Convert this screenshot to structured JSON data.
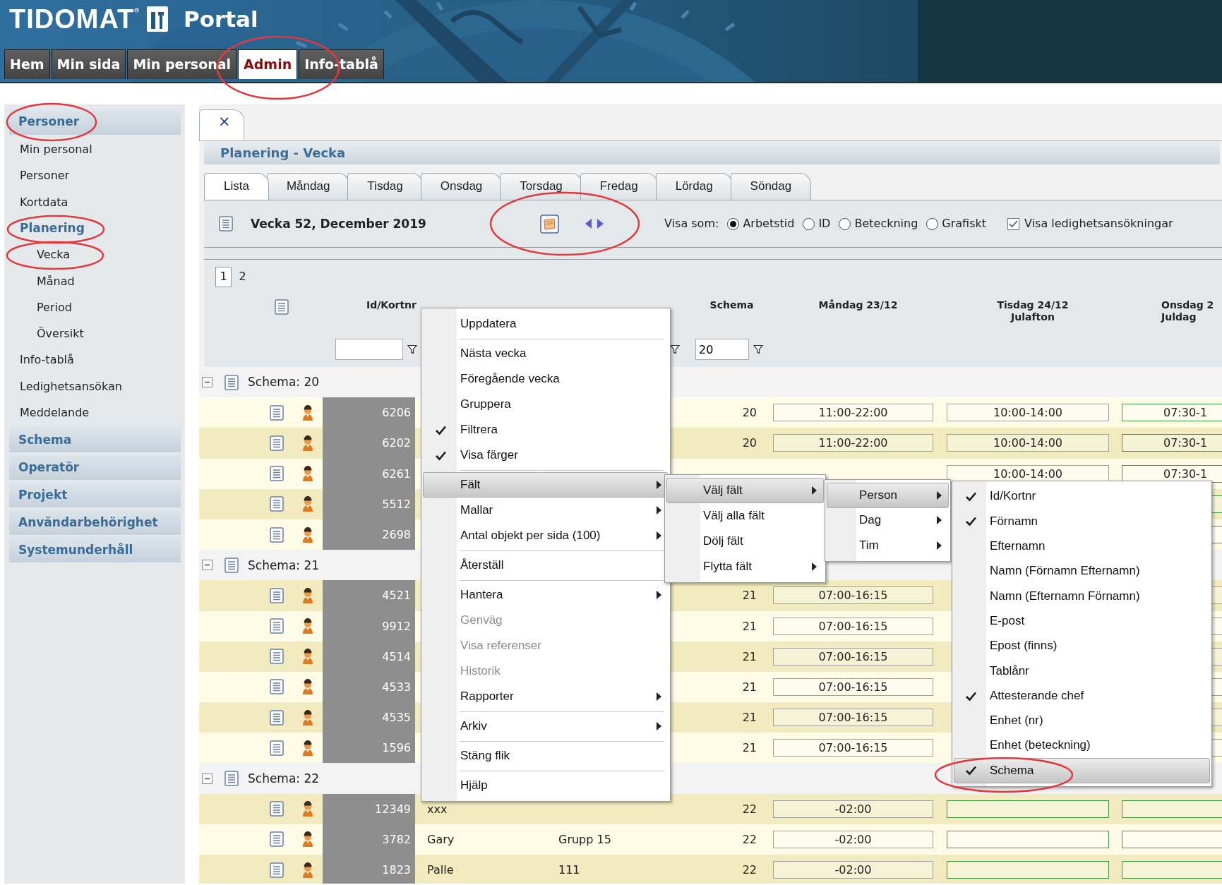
{
  "header": {
    "logo": "TIDOMAT$^{®}$",
    "title": "Portal"
  },
  "nav_tabs": [
    {
      "label": "Hem",
      "selected": false
    },
    {
      "label": "Min sida",
      "selected": false
    },
    {
      "label": "Min personal",
      "selected": false
    },
    {
      "label": "Admin",
      "selected": true
    },
    {
      "label": "Info-tablå",
      "selected": false
    }
  ],
  "sidebar": {
    "sections": [
      {
        "label": "Personer",
        "items": [
          {
            "label": "Min personal",
            "expanded": false
          },
          {
            "label": "Personer",
            "expanded": false
          },
          {
            "label": "Kortdata",
            "expanded": false
          },
          {
            "label": "Planering",
            "expanded": true,
            "children": [
              {
                "label": "Vecka"
              },
              {
                "label": "Månad"
              },
              {
                "label": "Period"
              },
              {
                "label": "Översikt"
              }
            ]
          },
          {
            "label": "Info-tablå",
            "expanded": false
          },
          {
            "label": "Ledighetsansökan",
            "expanded": false
          },
          {
            "label": "Meddelande",
            "expanded": false
          }
        ]
      },
      {
        "label": "Schema"
      },
      {
        "label": "Operatör"
      },
      {
        "label": "Projekt"
      },
      {
        "label": "Användarbehörighet"
      },
      {
        "label": "Systemunderhåll"
      }
    ]
  },
  "document_tab": {
    "close": "×"
  },
  "panel_title": "Planering - Vecka",
  "day_tabs": [
    {
      "label": "Lista",
      "selected": true
    },
    {
      "label": "Måndag",
      "selected": false
    },
    {
      "label": "Tisdag",
      "selected": false
    },
    {
      "label": "Onsdag",
      "selected": false
    },
    {
      "label": "Torsdag",
      "selected": false
    },
    {
      "label": "Fredag",
      "selected": false
    },
    {
      "label": "Lördag",
      "selected": false
    },
    {
      "label": "Söndag",
      "selected": false
    }
  ],
  "toolbar": {
    "week": "Vecka 52, December 2019",
    "view_label": "Visa som:",
    "view_options": [
      {
        "label": "Arbetstid",
        "selected": true
      },
      {
        "label": "ID",
        "selected": false
      },
      {
        "label": "Beteckning",
        "selected": false
      },
      {
        "label": "Grafiskt",
        "selected": false
      }
    ],
    "leave_requests": {
      "label": "Visa ledighetsansökningar",
      "checked": true
    }
  },
  "pager": [
    {
      "label": "1",
      "selected": true
    },
    {
      "label": "2",
      "selected": false
    }
  ],
  "table": {
    "headers": {
      "id": "Id/Kortnr",
      "schema": "Schema",
      "monday": [
        "Måndag 23/12"
      ],
      "tuesday": [
        "Tisdag 24/12",
        "Julafton"
      ],
      "wednesday": [
        "Onsdag 2",
        "Juldag"
      ]
    },
    "filters": {
      "schema": "20"
    },
    "groups": [
      {
        "label": "Schema: 20",
        "expanded": true,
        "rows": [
          {
            "id": "6206",
            "schema": "20",
            "monday": {
              "text": "11:00-22:00",
              "color": "#a0a0a0"
            },
            "tuesday": {
              "text": "10:00-14:00",
              "color": "#a0a0a0"
            },
            "wednesday": {
              "text": "07:30-1",
              "color": "#3c9a3c"
            }
          },
          {
            "id": "6202",
            "schema": "20",
            "monday": {
              "text": "11:00-22:00",
              "color": "#a0a0a0"
            },
            "tuesday": {
              "text": "10:00-14:00",
              "color": "#a0a0a0"
            },
            "wednesday": {
              "text": "07:30-1",
              "color": "#3c9a3c"
            }
          },
          {
            "id": "6261",
            "tuesday": {
              "text": "10:00-14:00",
              "color": "#a0a0a0"
            },
            "wednesday": {
              "text": "07:30-1",
              "color": "#3c9a3c"
            }
          },
          {
            "id": "5512",
            "wednesday": {
              "color": "#3c9a3c"
            }
          },
          {
            "id": "2698",
            "wednesday": {
              "color": "#3c9a3c"
            }
          }
        ]
      },
      {
        "label": "Schema: 21",
        "expanded": true,
        "rows": [
          {
            "id": "4521",
            "schema": "21",
            "monday": {
              "text": "07:00-16:15",
              "color": "#a0a0a0"
            },
            "wednesday": {
              "color": "#a0a0a0"
            }
          },
          {
            "id": "9912",
            "schema": "21",
            "monday": {
              "text": "07:00-16:15",
              "color": "#a0a0a0"
            },
            "wednesday": {
              "color": "#a0a0a0"
            }
          },
          {
            "id": "4514",
            "schema": "21",
            "monday": {
              "text": "07:00-16:15",
              "color": "#a0a0a0"
            },
            "wednesday": {
              "color": "#a0a0a0"
            }
          },
          {
            "id": "4533",
            "schema": "21",
            "monday": {
              "text": "07:00-16:15",
              "color": "#a0a0a0"
            },
            "wednesday": {
              "color": "#a0a0a0"
            }
          },
          {
            "id": "4535",
            "schema": "21",
            "monday": {
              "text": "07:00-16:15",
              "color": "#a0a0a0"
            },
            "wednesday": {
              "color": "#a0a0a0"
            }
          },
          {
            "id": "1596",
            "schema": "21",
            "monday": {
              "text": "07:00-16:15",
              "color": "#a0a0a0"
            },
            "wednesday": {
              "color": "#a0a0a0"
            }
          }
        ]
      },
      {
        "label": "Schema: 22",
        "expanded": true,
        "rows": [
          {
            "id": "12349",
            "column_3": "xxx",
            "schema": "22",
            "monday": {
              "text": "-02:00",
              "color": "#a0a0a0"
            },
            "tuesday": {
              "color": "#3c9a3c"
            },
            "wednesday": {
              "color": "#3c9a3c"
            }
          },
          {
            "id": "3782",
            "column_3": "Gary",
            "column_4": "Grupp 15",
            "schema": "22",
            "monday": {
              "text": "-02:00",
              "color": "#a0a0a0"
            },
            "tuesday": {
              "color": "#3c9a3c"
            },
            "wednesday": {
              "color": "#3c9a3c"
            }
          },
          {
            "id": "1823",
            "column_3": "Palle",
            "column_4": "111",
            "schema": "22",
            "monday": {
              "text": "-02:00",
              "color": "#a0a0a0"
            },
            "tuesday": {
              "color": "#3c9a3c"
            },
            "wednesday": {
              "color": "#3c9a3c"
            }
          }
        ]
      }
    ]
  },
  "context_menu": {
    "groups": [
      [
        {
          "label": "Uppdatera",
          "checked": false,
          "selected": false,
          "disabled": false,
          "submenu": false
        }
      ],
      [
        {
          "label": "Nästa vecka",
          "checked": false,
          "selected": false,
          "disabled": false,
          "submenu": false
        },
        {
          "label": "Föregående vecka",
          "checked": false,
          "selected": false,
          "disabled": false,
          "submenu": false
        },
        {
          "label": "Gruppera",
          "checked": false,
          "selected": false,
          "disabled": false,
          "submenu": false
        },
        {
          "label": "Filtrera",
          "checked": true,
          "selected": false,
          "disabled": false,
          "submenu": false
        },
        {
          "label": "Visa färger",
          "checked": true,
          "selected": false,
          "disabled": false,
          "submenu": false
        }
      ],
      [
        {
          "label": "Fält",
          "checked": false,
          "selected": true,
          "disabled": false,
          "submenu": true
        },
        {
          "label": "Mallar",
          "checked": false,
          "selected": false,
          "disabled": false,
          "submenu": true
        },
        {
          "label": "Antal objekt per sida (100)",
          "checked": false,
          "selected": false,
          "disabled": false,
          "submenu": true
        }
      ],
      [
        {
          "label": "Återställ",
          "checked": false,
          "selected": false,
          "disabled": false,
          "submenu": false
        }
      ],
      [
        {
          "label": "Hantera",
          "checked": false,
          "selected": false,
          "disabled": false,
          "submenu": true
        },
        {
          "label": "Genväg",
          "checked": false,
          "selected": false,
          "disabled": true,
          "submenu": false
        },
        {
          "label": "Visa referenser",
          "checked": false,
          "selected": false,
          "disabled": true,
          "submenu": false
        },
        {
          "label": "Historik",
          "checked": false,
          "selected": false,
          "disabled": true,
          "submenu": false
        },
        {
          "label": "Rapporter",
          "checked": false,
          "selected": false,
          "disabled": false,
          "submenu": true
        }
      ],
      [
        {
          "label": "Arkiv",
          "checked": false,
          "selected": false,
          "disabled": false,
          "submenu": true
        }
      ],
      [
        {
          "label": "Stäng flik",
          "checked": false,
          "selected": false,
          "disabled": false,
          "submenu": false
        }
      ],
      [
        {
          "label": "Hjälp",
          "checked": false,
          "selected": false,
          "disabled": false,
          "submenu": false
        }
      ]
    ]
  },
  "submenus": [
    {
      "groups": [
        [
          {
            "label": "Välj fält",
            "checked": false,
            "selected": true,
            "disabled": false,
            "submenu": true
          },
          {
            "label": "Välj alla fält",
            "checked": false,
            "selected": false,
            "disabled": false,
            "submenu": false
          },
          {
            "label": "Dölj fält",
            "checked": false,
            "selected": false,
            "disabled": false,
            "submenu": false
          },
          {
            "label": "Flytta fält",
            "checked": false,
            "selected": false,
            "disabled": false,
            "submenu": true
          }
        ]
      ]
    },
    {
      "groups": [
        [
          {
            "label": "Person",
            "checked": false,
            "selected": true,
            "disabled": false,
            "submenu": true
          },
          {
            "label": "Dag",
            "checked": false,
            "selected": false,
            "disabled": false,
            "submenu": true
          },
          {
            "label": "Tim",
            "checked": false,
            "selected": false,
            "disabled": false,
            "submenu": true
          }
        ]
      ]
    },
    {
      "groups": [
        [
          {
            "label": "Id/Kortnr",
            "checked": true,
            "selected": false,
            "disabled": false,
            "submenu": false
          },
          {
            "label": "Förnamn",
            "checked": true,
            "selected": false,
            "disabled": false,
            "submenu": false
          },
          {
            "label": "Efternamn",
            "checked": false,
            "selected": false,
            "disabled": false,
            "submenu": false
          },
          {
            "label": "Namn (Förnamn Efternamn)",
            "checked": false,
            "selected": false,
            "disabled": false,
            "submenu": false
          },
          {
            "label": "Namn (Efternamn Förnamn)",
            "checked": false,
            "selected": false,
            "disabled": false,
            "submenu": false
          },
          {
            "label": "E-post",
            "checked": false,
            "selected": false,
            "disabled": false,
            "submenu": false
          },
          {
            "label": "Epost (finns)",
            "checked": false,
            "selected": false,
            "disabled": false,
            "submenu": false
          },
          {
            "label": "Tablånr",
            "checked": false,
            "selected": false,
            "disabled": false,
            "submenu": false
          },
          {
            "label": "Attesterande chef",
            "checked": true,
            "selected": false,
            "disabled": false,
            "submenu": false
          },
          {
            "label": "Enhet (nr)",
            "checked": false,
            "selected": false,
            "disabled": false,
            "submenu": false
          },
          {
            "label": "Enhet (beteckning)",
            "checked": false,
            "selected": false,
            "disabled": false,
            "submenu": false
          },
          {
            "label": "Schema",
            "checked": true,
            "selected": true,
            "disabled": false,
            "submenu": false
          }
        ]
      ]
    }
  ]
}
